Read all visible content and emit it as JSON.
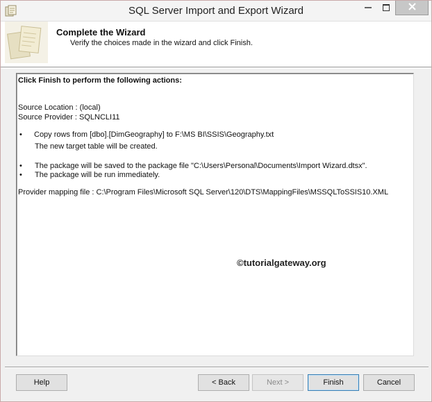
{
  "window": {
    "title": "SQL Server Import and Export Wizard"
  },
  "header": {
    "title": "Complete the Wizard",
    "subtitle": "Verify the choices made in the wizard and click Finish."
  },
  "content": {
    "heading": "Click Finish to perform the following actions:",
    "source_location": "Source Location : (local)",
    "source_provider": "Source Provider : SQLNCLI11",
    "bullet_glyph": "•",
    "copy_rows": "Copy rows from [dbo].[DimGeography] to F:\\MS BI\\SSIS\\Geography.txt",
    "new_target": "The new target table will be created.",
    "package_saved": "The package will be saved to the package file \"C:\\Users\\Personal\\Documents\\Import Wizard.dtsx\".",
    "package_run": "The package will be run immediately.",
    "mapping_file": "Provider mapping file : C:\\Program Files\\Microsoft SQL Server\\120\\DTS\\MappingFiles\\MSSQLToSSIS10.XML",
    "watermark": "©tutorialgateway.org"
  },
  "buttons": {
    "help": "Help",
    "back": "< Back",
    "next": "Next >",
    "finish": "Finish",
    "cancel": "Cancel"
  },
  "icons": {
    "app": "wizard-app-icon",
    "header": "wizard-header-icon",
    "minimize": "minimize-icon",
    "maximize": "maximize-icon",
    "close": "close-icon"
  }
}
